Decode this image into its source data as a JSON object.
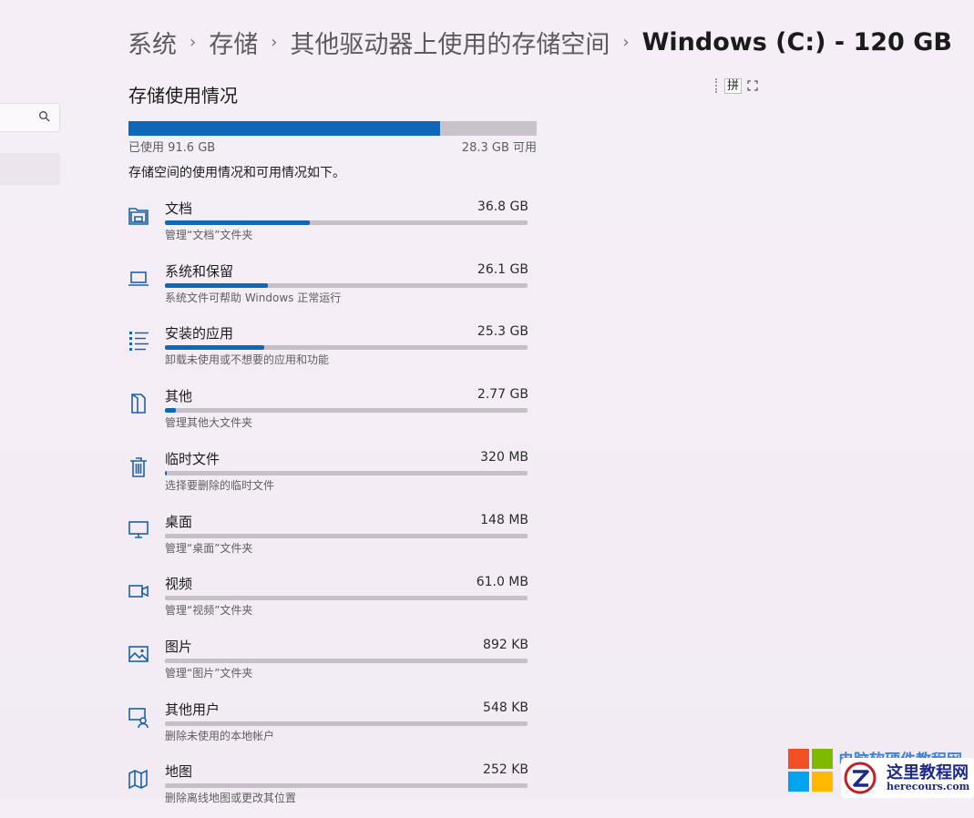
{
  "breadcrumb": {
    "items": [
      "系统",
      "存储",
      "其他驱动器上使用的存储空间"
    ],
    "current": "Windows (C:) - 120 GB",
    "separator": "›"
  },
  "section_title": "存储使用情况",
  "ime": {
    "mode_label": "拼"
  },
  "usage": {
    "used_label": "已使用 91.6 GB",
    "free_label": "28.3 GB 可用",
    "used_fraction": 0.764,
    "description": "存储空间的使用情况和可用情况如下。"
  },
  "categories": [
    {
      "name": "文档",
      "size": "36.8 GB",
      "sub": "管理“文档”文件夹",
      "fraction": 0.4,
      "icon": "documents-icon"
    },
    {
      "name": "系统和保留",
      "size": "26.1 GB",
      "sub": "系统文件可帮助 Windows 正常运行",
      "fraction": 0.285,
      "icon": "laptop-icon"
    },
    {
      "name": "安装的应用",
      "size": "25.3 GB",
      "sub": "卸载未使用或不想要的应用和功能",
      "fraction": 0.275,
      "icon": "apps-list-icon"
    },
    {
      "name": "其他",
      "size": "2.77 GB",
      "sub": "管理其他大文件夹",
      "fraction": 0.03,
      "icon": "folder-other-icon"
    },
    {
      "name": "临时文件",
      "size": "320 MB",
      "sub": "选择要删除的临时文件",
      "fraction": 0.004,
      "icon": "trash-icon"
    },
    {
      "name": "桌面",
      "size": "148 MB",
      "sub": "管理“桌面”文件夹",
      "fraction": 0.0,
      "icon": "monitor-icon"
    },
    {
      "name": "视频",
      "size": "61.0 MB",
      "sub": "管理“视频”文件夹",
      "fraction": 0.0,
      "icon": "video-icon"
    },
    {
      "name": "图片",
      "size": "892 KB",
      "sub": "管理“图片”文件夹",
      "fraction": 0.0,
      "icon": "picture-icon"
    },
    {
      "name": "其他用户",
      "size": "548 KB",
      "sub": "删除未使用的本地帐户",
      "fraction": 0.0,
      "icon": "other-users-icon"
    },
    {
      "name": "地图",
      "size": "252 KB",
      "sub": "删除离线地图或更改其位置",
      "fraction": 0.0,
      "icon": "map-icon"
    }
  ],
  "watermark": {
    "top_text": "电脑软硬件教程网",
    "name": "这里教程网",
    "url": "herecours.com"
  },
  "colors": {
    "accent": "#0f67b7",
    "track": "#c6bfc8",
    "background": "#f5eef6"
  }
}
